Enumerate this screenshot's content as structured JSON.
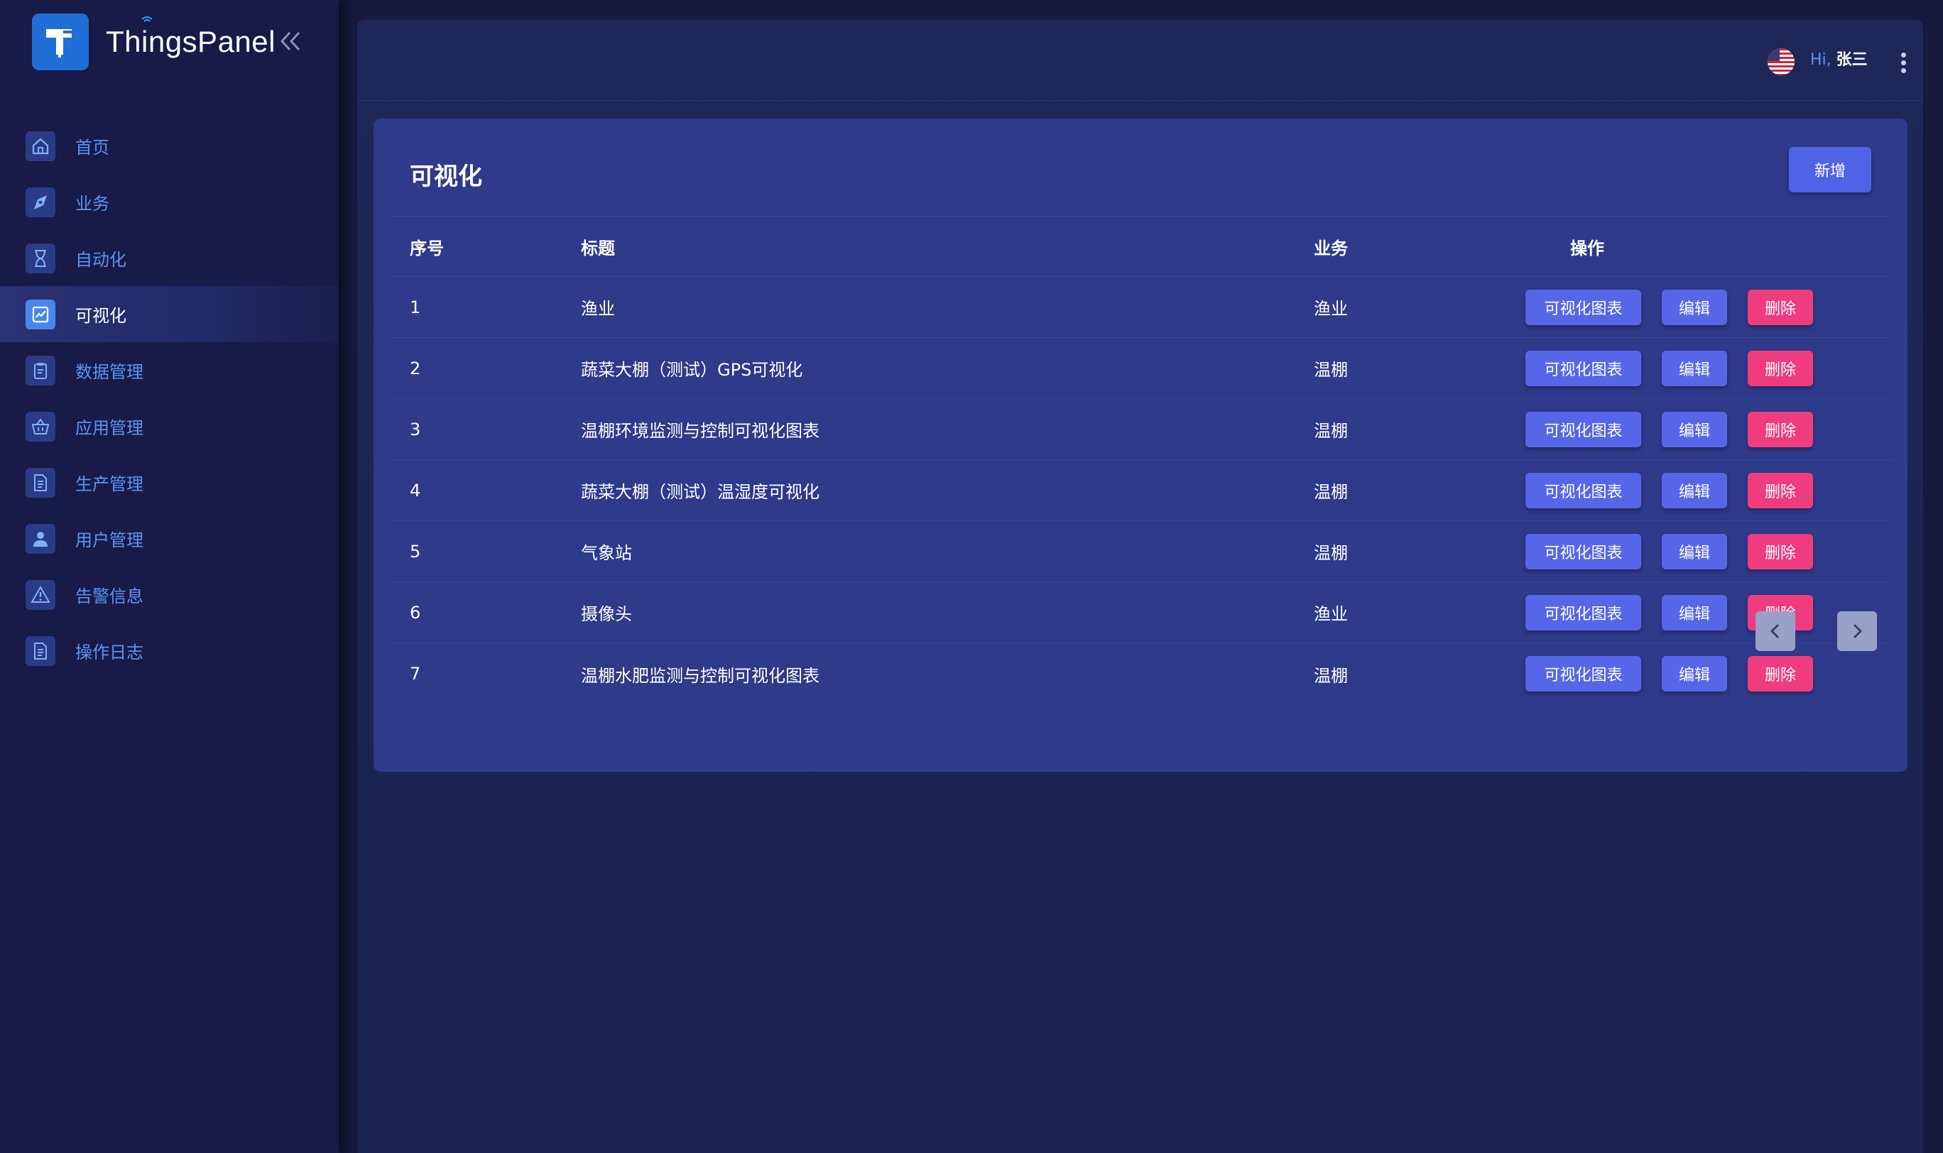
{
  "app": {
    "brand_name": "ThingsPanel"
  },
  "sidebar": {
    "items": [
      {
        "label": "首页",
        "icon": "home-icon",
        "active": false
      },
      {
        "label": "业务",
        "icon": "compass-icon",
        "active": false
      },
      {
        "label": "自动化",
        "icon": "hourglass-icon",
        "active": false
      },
      {
        "label": "可视化",
        "icon": "chart-board-icon",
        "active": true
      },
      {
        "label": "数据管理",
        "icon": "clipboard-icon",
        "active": false
      },
      {
        "label": "应用管理",
        "icon": "basket-icon",
        "active": false
      },
      {
        "label": "生产管理",
        "icon": "document-icon",
        "active": false
      },
      {
        "label": "用户管理",
        "icon": "user-icon",
        "active": false
      },
      {
        "label": "告警信息",
        "icon": "warning-icon",
        "active": false
      },
      {
        "label": "操作日志",
        "icon": "log-document-icon",
        "active": false
      }
    ]
  },
  "header": {
    "language_flag": "us-flag-icon",
    "greeting_prefix": "Hi,",
    "user_name": "张三"
  },
  "page": {
    "title": "可视化",
    "add_label": "新增"
  },
  "table": {
    "columns": [
      "序号",
      "标题",
      "业务",
      "操作"
    ],
    "actions": {
      "chart_label": "可视化图表",
      "edit_label": "编辑",
      "delete_label": "删除"
    },
    "rows": [
      {
        "no": "1",
        "title": "渔业",
        "business": "渔业"
      },
      {
        "no": "2",
        "title": "蔬菜大棚（测试）GPS可视化",
        "business": "温棚"
      },
      {
        "no": "3",
        "title": "温棚环境监测与控制可视化图表",
        "business": "温棚"
      },
      {
        "no": "4",
        "title": "蔬菜大棚（测试）温湿度可视化",
        "business": "温棚"
      },
      {
        "no": "5",
        "title": "气象站",
        "business": "温棚"
      },
      {
        "no": "6",
        "title": "摄像头",
        "business": "渔业"
      },
      {
        "no": "7",
        "title": "温棚水肥监测与控制可视化图表",
        "business": "温棚"
      }
    ]
  },
  "colors": {
    "sidebar_bg": "#181b47",
    "card_bg": "#2e3a8a",
    "primary_button": "#5567e8",
    "danger_button": "#ee3c7e",
    "menu_text": "#5b93f2"
  }
}
